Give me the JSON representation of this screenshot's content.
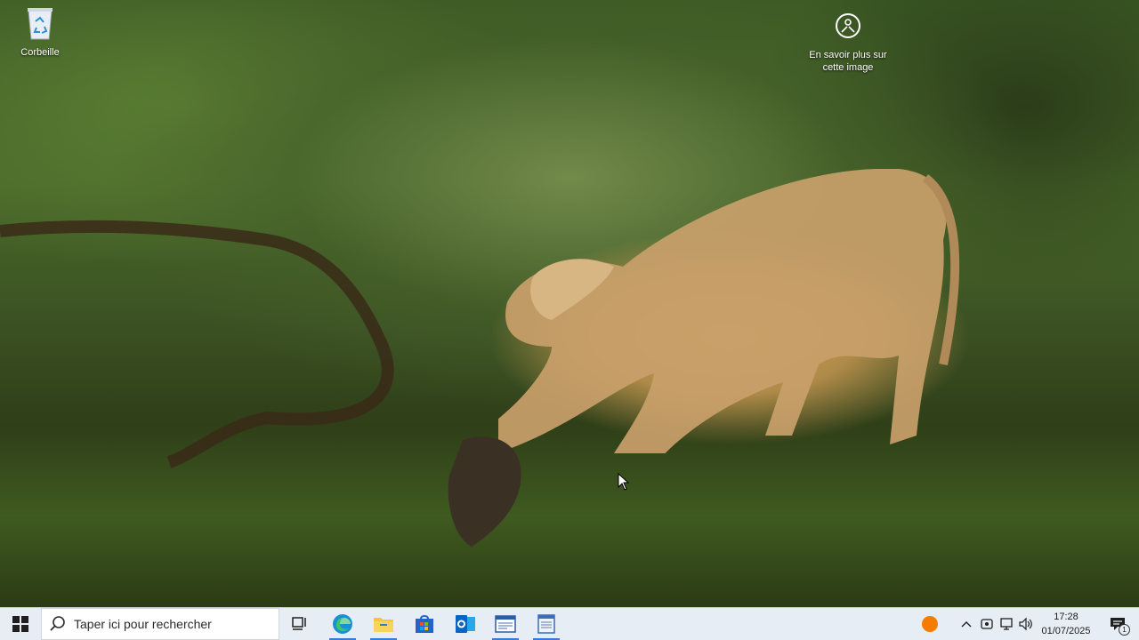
{
  "desktop": {
    "icons": [
      {
        "label": "Corbeille",
        "icon": "recycle-bin-icon"
      },
      {
        "label": "En savoir plus sur cette image",
        "icon": "learn-more-icon"
      }
    ]
  },
  "taskbar": {
    "search_placeholder": "Taper ici pour rechercher",
    "pinned_apps": [
      {
        "name": "Task View",
        "icon": "task-view-icon"
      },
      {
        "name": "Microsoft Edge",
        "icon": "edge-icon",
        "active": true
      },
      {
        "name": "Explorateur de fichiers",
        "icon": "folder-icon",
        "active": true
      },
      {
        "name": "Microsoft Store",
        "icon": "store-icon"
      },
      {
        "name": "Outlook",
        "icon": "outlook-icon"
      },
      {
        "name": "Application",
        "icon": "app-window-icon",
        "active": true
      },
      {
        "name": "Application",
        "icon": "app-window-icon",
        "active": true
      }
    ],
    "tray": {
      "time": "17:28",
      "date": "01/07/2025",
      "notification_count": "1"
    }
  },
  "colors": {
    "taskbar_bg": "#e6edf4",
    "active_indicator": "#3b78d8",
    "tray_orange": "#f57c00"
  }
}
